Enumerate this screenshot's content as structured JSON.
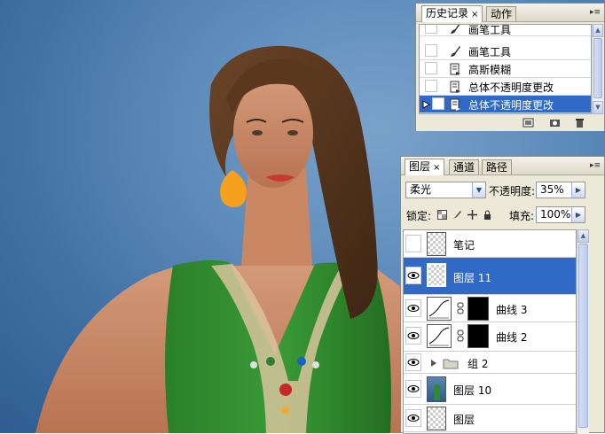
{
  "canvas": {
    "background_color": "#4a7bae"
  },
  "history_panel": {
    "tabs": [
      {
        "label": "历史记录",
        "close": "×"
      },
      {
        "label": "动作"
      }
    ],
    "menu_glyph": "▸≡",
    "items": [
      {
        "label": "画笔工具",
        "icon": "brush-icon"
      },
      {
        "label": "画笔工具",
        "icon": "brush-icon"
      },
      {
        "label": "高斯模糊",
        "icon": "filter-step-icon"
      },
      {
        "label": "总体不透明度更改",
        "icon": "history-step-icon"
      },
      {
        "label": "总体不透明度更改",
        "icon": "history-step-icon",
        "selected": true
      }
    ],
    "footer_icons": [
      "new-document-from-state-icon",
      "create-snapshot-icon",
      "trash-icon"
    ]
  },
  "layers_panel": {
    "tabs": [
      {
        "label": "图层",
        "close": "×"
      },
      {
        "label": "通道"
      },
      {
        "label": "路径"
      }
    ],
    "blend_mode": "柔光",
    "opacity_label": "不透明度:",
    "opacity_value": "35%",
    "lock_label": "锁定:",
    "fill_label": "填充:",
    "fill_value": "100%",
    "layers": [
      {
        "name": "笔记",
        "visible": false,
        "type": "transparent"
      },
      {
        "name": "图层 11",
        "visible": true,
        "type": "transparent",
        "selected": true
      },
      {
        "name": "曲线 3",
        "visible": true,
        "type": "adjustment"
      },
      {
        "name": "曲线 2",
        "visible": true,
        "type": "adjustment"
      },
      {
        "name": "组 2",
        "visible": true,
        "type": "group"
      },
      {
        "name": "图层 10",
        "visible": true,
        "type": "photo"
      },
      {
        "name": "图层",
        "visible": true,
        "type": "transparent"
      }
    ]
  },
  "colors": {
    "selection_blue": "#3169c6",
    "panel_gray": "#ece9d8",
    "dress_green": "#2f8a2c",
    "earring_orange": "#f5a11d"
  }
}
